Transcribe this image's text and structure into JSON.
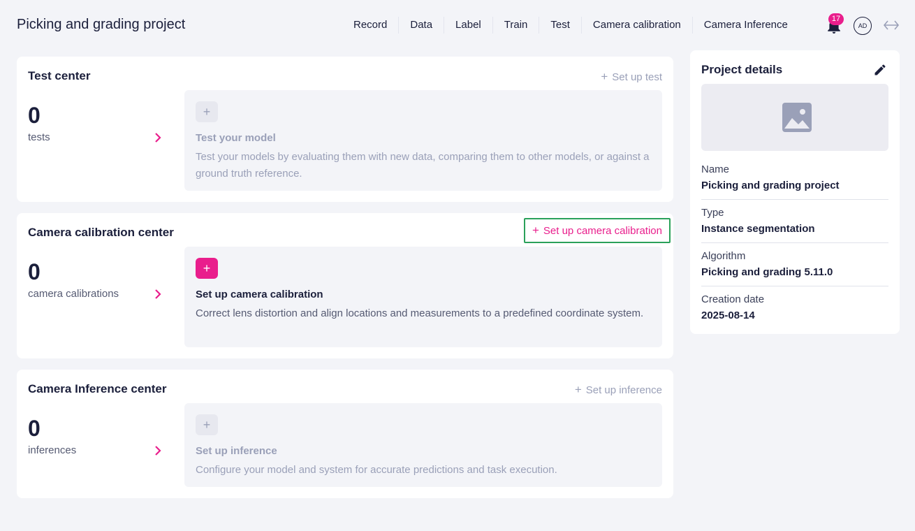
{
  "app": {
    "title": "Picking and grading project"
  },
  "nav": {
    "items": [
      "Record",
      "Data",
      "Label",
      "Train",
      "Test",
      "Camera calibration",
      "Camera Inference"
    ]
  },
  "header": {
    "notification_count": "17",
    "avatar_initials": "AD",
    "icons": [
      "bell-icon",
      "expand-icon"
    ]
  },
  "test_center": {
    "title": "Test center",
    "setup_label": "Set up test",
    "count": "0",
    "count_label": "tests",
    "empty_title": "Test your model",
    "empty_desc": "Test your models by evaluating them with new data, comparing them to other models, or against a ground truth reference."
  },
  "calibration_center": {
    "title": "Camera calibration center",
    "setup_label": "Set up camera calibration",
    "count": "0",
    "count_label": "camera calibrations",
    "empty_title": "Set up camera calibration",
    "empty_desc": "Correct lens distortion and align locations and measurements to a predefined coordinate system."
  },
  "inference_center": {
    "title": "Camera Inference center",
    "setup_label": "Set up inference",
    "count": "0",
    "count_label": "inferences",
    "empty_title": "Set up inference",
    "empty_desc": "Configure your model and system for accurate predictions and task execution."
  },
  "project_details": {
    "title": "Project details",
    "fields": [
      {
        "label": "Name",
        "value": "Picking and grading project"
      },
      {
        "label": "Type",
        "value": "Instance segmentation"
      },
      {
        "label": "Algorithm",
        "value": "Picking and grading 5.11.0"
      },
      {
        "label": "Creation date",
        "value": "2025-08-14"
      }
    ]
  },
  "colors": {
    "accent": "#e91e8c",
    "focus_outline": "#2ba15a",
    "text": "#1b1f3b",
    "muted": "#9aa0b8"
  }
}
